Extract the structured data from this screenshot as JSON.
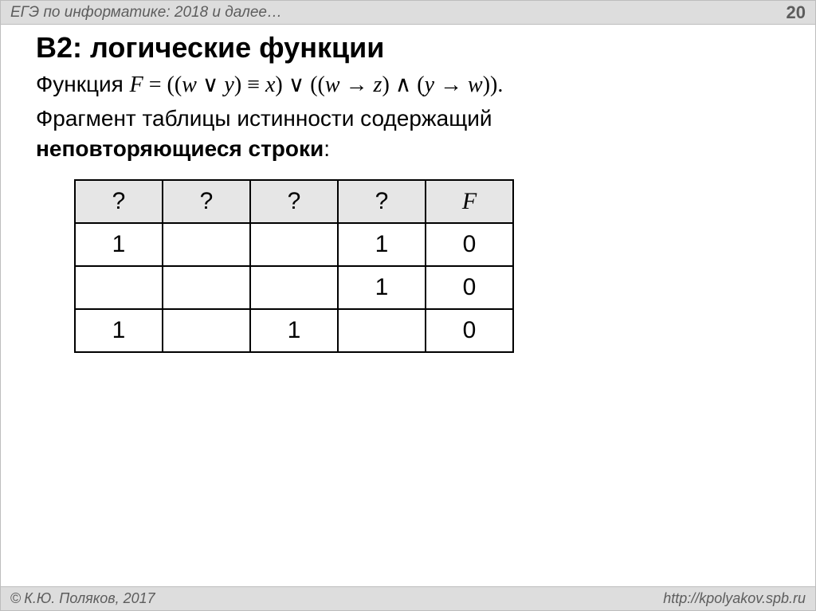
{
  "header": {
    "subject": "ЕГЭ по информатике: 2018 и далее…",
    "page_number": "20"
  },
  "title": "B2: логические функции",
  "formula": {
    "prefix": "Функция ",
    "F": "F",
    "eq": " = ((",
    "w1": "w",
    "or1": " ∨ ",
    "y1": "y",
    "close1": ") ",
    "equiv": "≡",
    "sp1": " ",
    "x": "x",
    "close2": ") ",
    "or2": "∨",
    "open3": " ((",
    "w2": "w",
    "impl1": " → ",
    "z": "z",
    "close3": ") ",
    "and": "∧",
    "open4": " (",
    "y2": "y",
    "impl2": " → ",
    "w3": "w",
    "close4": "))."
  },
  "description": {
    "line1": "Фрагмент таблицы истинности содержащий",
    "line2_bold": "неповторяющиеся строки",
    "line2_tail": ":"
  },
  "table": {
    "headers": [
      "?",
      "?",
      "?",
      "?",
      "F"
    ],
    "rows": [
      [
        "1",
        "",
        "",
        "1",
        "0"
      ],
      [
        "",
        "",
        "",
        "1",
        "0"
      ],
      [
        "1",
        "",
        "1",
        "",
        "0"
      ]
    ]
  },
  "footer": {
    "copyright": "К.Ю. Поляков, 2017",
    "url": "http://kpolyakov.spb.ru"
  }
}
